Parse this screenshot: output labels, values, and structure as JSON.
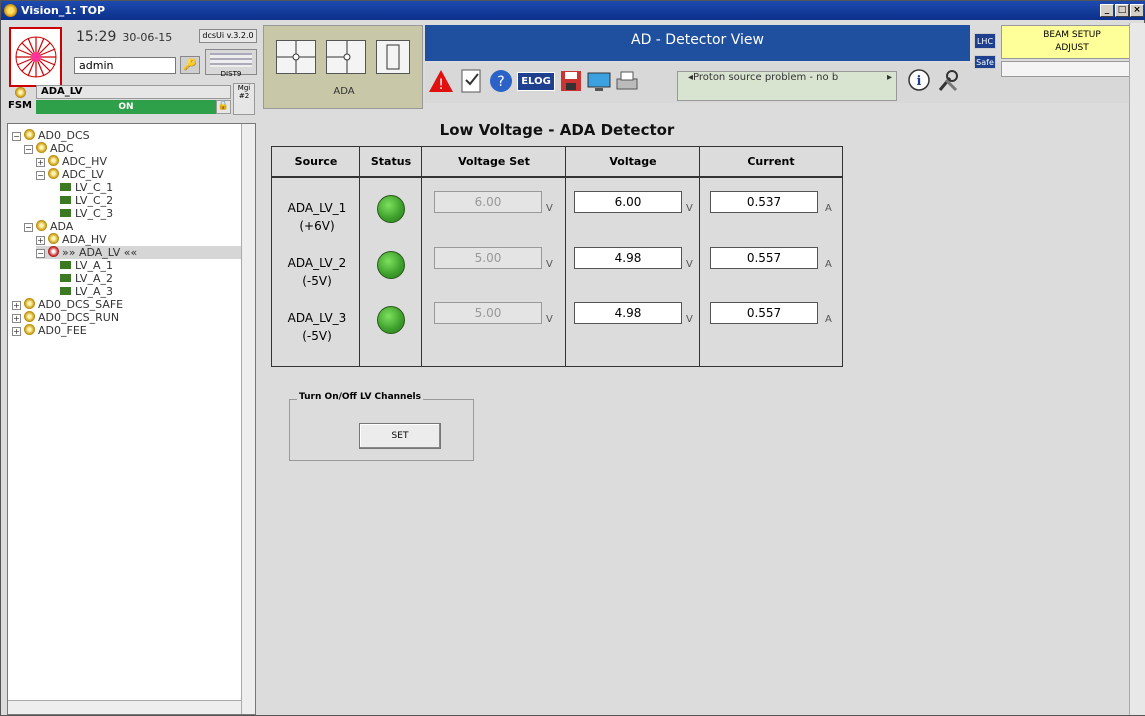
{
  "window": {
    "title": "Vision_1: TOP"
  },
  "header": {
    "time": "15:29",
    "date": "30-06-15",
    "version": "dcsUi v.3.2.0",
    "user": "admin",
    "dist": "DIST9",
    "mgi": "Mgi",
    "mgi_num": "#2"
  },
  "fsm": {
    "label": "FSM",
    "name": "ADA_LV",
    "state": "ON",
    "state_color": "#2fa04a"
  },
  "tree": {
    "items": [
      {
        "label": "AD0_DCS"
      },
      {
        "label": "ADC"
      },
      {
        "label": "ADC_HV"
      },
      {
        "label": "ADC_LV"
      },
      {
        "label": "LV_C_1"
      },
      {
        "label": "LV_C_2"
      },
      {
        "label": "LV_C_3"
      },
      {
        "label": "ADA"
      },
      {
        "label": "ADA_HV"
      },
      {
        "label": "»» ADA_LV ««"
      },
      {
        "label": "LV_A_1"
      },
      {
        "label": "LV_A_2"
      },
      {
        "label": "LV_A_3"
      },
      {
        "label": "AD0_DCS_SAFE"
      },
      {
        "label": "AD0_DCS_RUN"
      },
      {
        "label": "AD0_FEE"
      }
    ]
  },
  "top": {
    "ada_label": "ADA",
    "view_title": "AD - Detector View",
    "message": "Proton source problem - no b",
    "lhc": "LHC",
    "safe": "Safe",
    "beam_line1": "BEAM SETUP",
    "beam_line2": "ADJUST",
    "toolbar_elog": "ELOG"
  },
  "main": {
    "title": "Low Voltage - ADA Detector",
    "headers": {
      "source": "Source",
      "status": "Status",
      "voltage_set": "Voltage Set",
      "voltage": "Voltage",
      "current": "Current"
    },
    "rows": [
      {
        "name": "ADA_LV_1",
        "range": "(+6V)",
        "vset": "6.00",
        "voltage": "6.00",
        "current": "0.537",
        "vunit": "V",
        "iunit": "A"
      },
      {
        "name": "ADA_LV_2",
        "range": "(-5V)",
        "vset": "5.00",
        "voltage": "4.98",
        "current": "0.557",
        "vunit": "V",
        "iunit": "A"
      },
      {
        "name": "ADA_LV_3",
        "range": "(-5V)",
        "vset": "5.00",
        "voltage": "4.98",
        "current": "0.557",
        "vunit": "V",
        "iunit": "A"
      }
    ],
    "channels_group": "Turn On/Off LV Channels",
    "set_label": "SET"
  }
}
